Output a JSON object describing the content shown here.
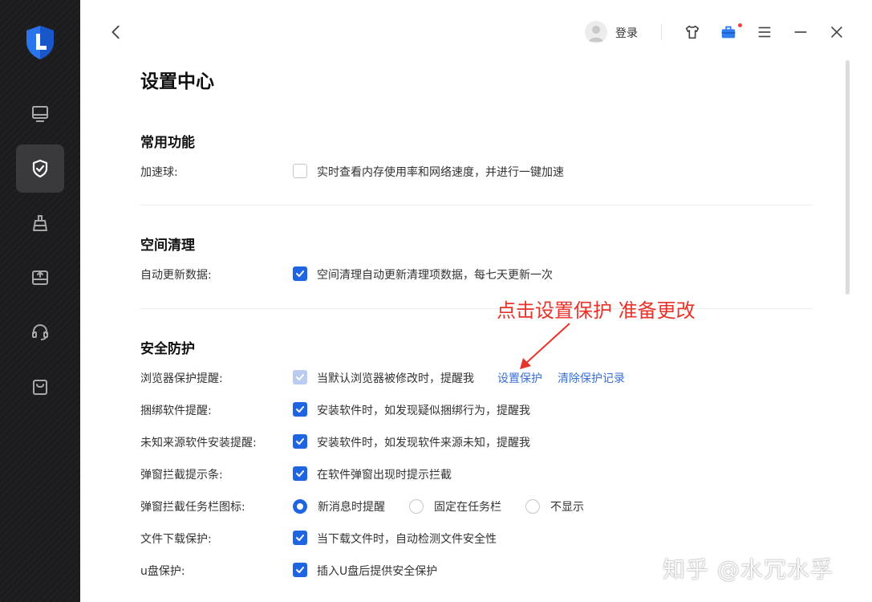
{
  "header": {
    "login_label": "登录"
  },
  "page": {
    "title": "设置中心"
  },
  "sections": {
    "common": {
      "title": "常用功能",
      "accelerator": {
        "label": "加速球:",
        "desc": "实时查看内存使用率和网络速度，并进行一键加速",
        "checked": false
      }
    },
    "cleanup": {
      "title": "空间清理",
      "auto_update": {
        "label": "自动更新数据:",
        "desc": "空间清理自动更新清理项数据，每七天更新一次",
        "checked": true
      }
    },
    "security": {
      "title": "安全防护",
      "browser_protect": {
        "label": "浏览器保护提醒:",
        "desc": "当默认浏览器被修改时，提醒我",
        "checked": true,
        "disabled": true,
        "link_set": "设置保护",
        "link_clear": "清除保护记录"
      },
      "bundle_alert": {
        "label": "捆绑软件提醒:",
        "desc": "安装软件时，如发现疑似捆绑行为，提醒我",
        "checked": true
      },
      "unknown_source": {
        "label": "未知来源软件安装提醒:",
        "desc": "安装软件时，如发现软件来源未知，提醒我",
        "checked": true
      },
      "popup_bar": {
        "label": "弹窗拦截提示条:",
        "desc": "在软件弹窗出现时提示拦截",
        "checked": true
      },
      "popup_taskbar": {
        "label": "弹窗拦截任务栏图标:",
        "options": [
          "新消息时提醒",
          "固定在任务栏",
          "不显示"
        ],
        "selected": "新消息时提醒"
      },
      "download_protect": {
        "label": "文件下载保护:",
        "desc": "当下载文件时，自动检测文件安全性",
        "checked": true
      },
      "usb_protect": {
        "label": "u盘保护:",
        "desc": "插入U盘后提供安全保护",
        "checked": true
      }
    }
  },
  "annotation": {
    "text": "点击设置保护 准备更改",
    "color": "#e8332a"
  },
  "watermark": "知乎 @水冗水孚",
  "colors": {
    "accent": "#1f64e0",
    "link": "#3b6fd4",
    "sidebar_bg": "#1c1c1e"
  },
  "icons": {
    "sidebar": [
      "logo-shield-icon",
      "monitor-icon",
      "shield-check-icon",
      "broom-icon",
      "drive-icon",
      "headset-icon",
      "bag-icon"
    ],
    "topbar": [
      "back-chevron-icon",
      "avatar-icon",
      "shirt-icon",
      "toolbox-icon",
      "menu-icon",
      "minimize-icon",
      "close-icon"
    ]
  }
}
